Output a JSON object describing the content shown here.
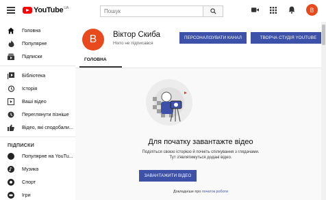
{
  "header": {
    "logo_text": "YouTube",
    "logo_region": "UA",
    "search_placeholder": "Пошук"
  },
  "sidebar": {
    "main_items": [
      {
        "label": "Головна",
        "icon": "home-icon"
      },
      {
        "label": "Популярне",
        "icon": "flame-icon"
      },
      {
        "label": "Підписки",
        "icon": "subscriptions-icon"
      }
    ],
    "library_items": [
      {
        "label": "Бібліотека",
        "icon": "library-icon"
      },
      {
        "label": "Історія",
        "icon": "history-icon"
      },
      {
        "label": "Ваші відео",
        "icon": "your-videos-icon"
      },
      {
        "label": "Переглянути пізніше",
        "icon": "watch-later-icon"
      },
      {
        "label": "Відео, які сподобали...",
        "icon": "like-icon"
      }
    ],
    "subscriptions_heading": "ПІДПИСКИ",
    "subscription_items": [
      {
        "label": "Популярне на YouTu..."
      },
      {
        "label": "Музика"
      },
      {
        "label": "Спорт"
      },
      {
        "label": "Ігри"
      }
    ]
  },
  "channel": {
    "avatar_letter": "В",
    "name": "Віктор Скиба",
    "subscribers": "Ніхто не підписався",
    "customize_button": "ПЕРСОНАЛІЗУВАТИ КАНАЛ",
    "studio_button": "ТВОРЧА СТУДІЯ YOUTUBE",
    "tab_home": "ГОЛОВНА"
  },
  "empty_state": {
    "title": "Для початку завантажте відео",
    "description": "Поділіться своєю історією й почніть спілкування з глядачами. Тут з'являтимуться додані відео.",
    "upload_button": "ЗАВАНТАЖИТИ ВІДЕО",
    "learn_prefix": "Докладніше про",
    "learn_link": "початок роботи"
  },
  "colors": {
    "accent": "#3e51a8",
    "avatar": "#e8491d",
    "logo_red": "#ff0000"
  }
}
